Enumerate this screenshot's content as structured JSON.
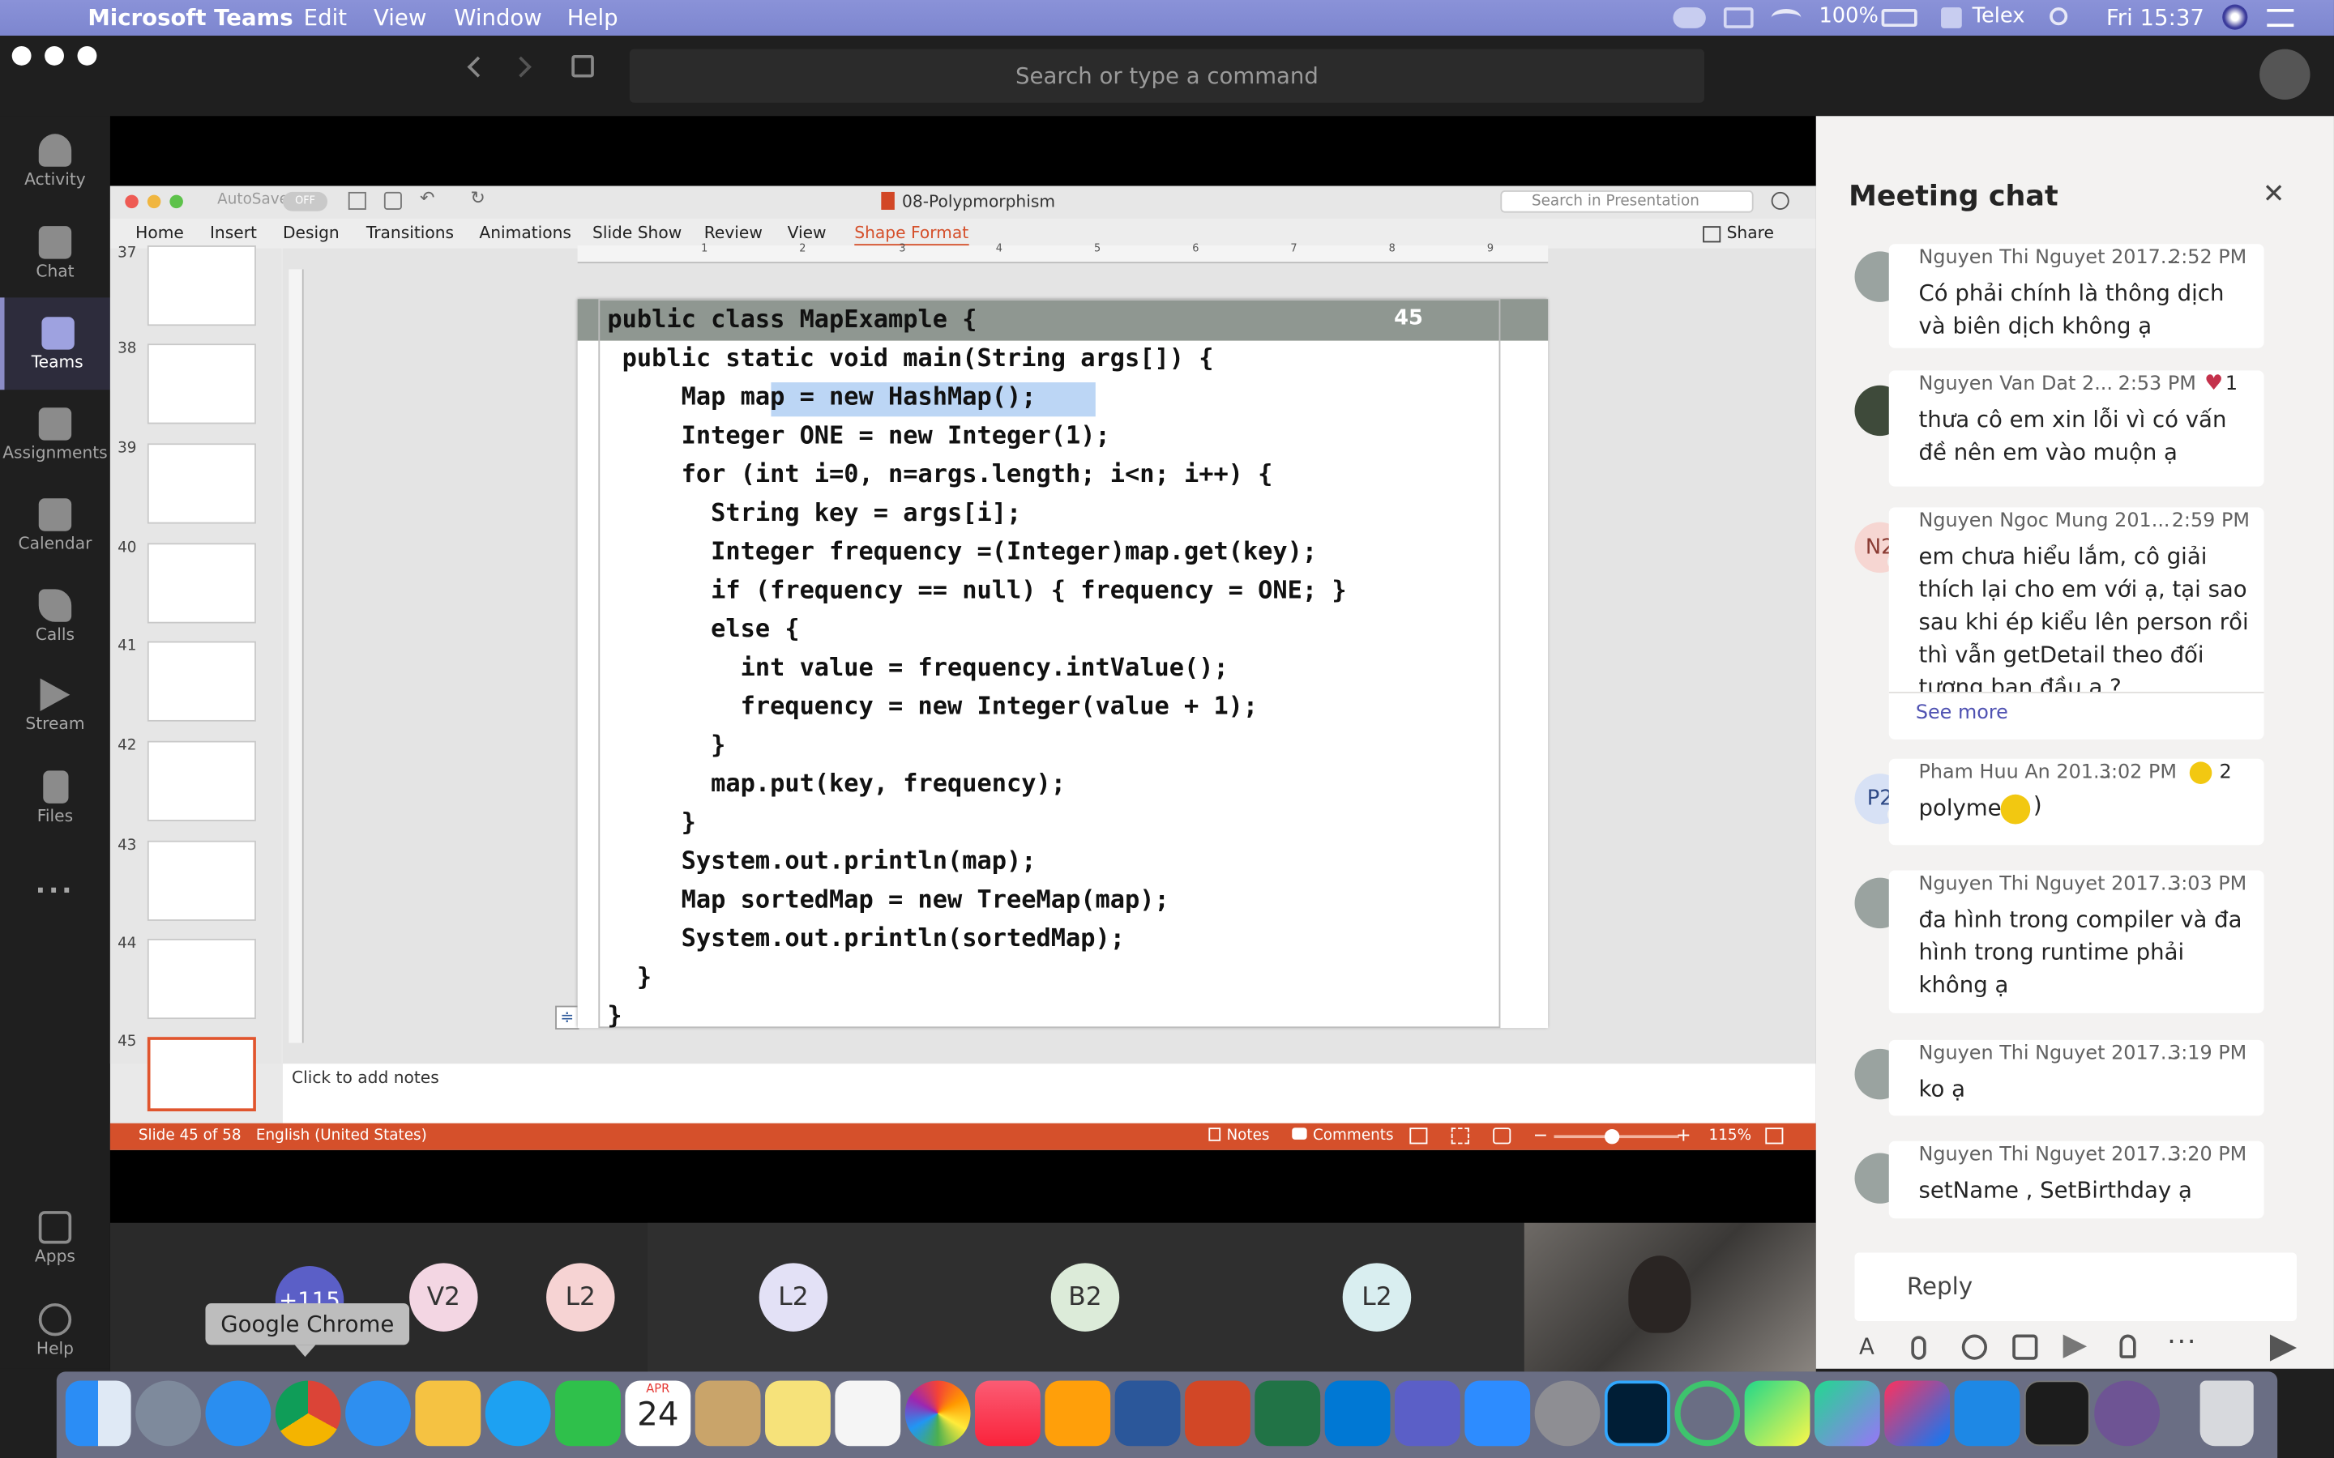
{
  "menubar": {
    "app_name": "Microsoft Teams",
    "menus": [
      "Edit",
      "View",
      "Window",
      "Help"
    ],
    "battery": "100%",
    "input_method": "Telex",
    "clock": "Fri 15:37"
  },
  "teams_header": {
    "search_placeholder": "Search or type a command"
  },
  "rail": {
    "items": [
      {
        "label": "Activity",
        "icon": "bell-icon"
      },
      {
        "label": "Chat",
        "icon": "chat-icon"
      },
      {
        "label": "Teams",
        "icon": "teams-icon"
      },
      {
        "label": "Assignments",
        "icon": "assignments-icon"
      },
      {
        "label": "Calendar",
        "icon": "calendar-icon"
      },
      {
        "label": "Calls",
        "icon": "phone-icon"
      },
      {
        "label": "Stream",
        "icon": "stream-icon"
      },
      {
        "label": "Files",
        "icon": "files-icon"
      },
      {
        "label": "...",
        "icon": "more-icon"
      },
      {
        "label": "Apps",
        "icon": "apps-icon"
      },
      {
        "label": "Help",
        "icon": "help-icon"
      }
    ]
  },
  "powerpoint": {
    "autosave_label": "AutoSave",
    "autosave_state": "OFF",
    "doc_title": "08-Polypmorphism",
    "search_placeholder": "Search in Presentation",
    "share_label": "Share",
    "tabs": [
      "Home",
      "Insert",
      "Design",
      "Transitions",
      "Animations",
      "Slide Show",
      "Review",
      "View",
      "Shape Format"
    ],
    "ruler_numbers": [
      "1",
      "2",
      "3",
      "4",
      "5",
      "6",
      "7",
      "8",
      "9"
    ],
    "slide_numbers": [
      "37",
      "38",
      "39",
      "40",
      "41",
      "42",
      "43",
      "44",
      "45"
    ],
    "slide": {
      "page_number": "45",
      "code_lines": [
        "public class MapExample {",
        " public static void main(String args[]) {",
        "     Map map = new HashMap();",
        "     Integer ONE = new Integer(1);",
        "     for (int i=0, n=args.length; i<n; i++) {",
        "       String key = args[i];",
        "       Integer frequency =(Integer)map.get(key);",
        "       if (frequency == null) { frequency = ONE; }",
        "       else {",
        "         int value = frequency.intValue();",
        "         frequency = new Integer(value + 1);",
        "       }",
        "       map.put(key, frequency);",
        "     }",
        "     System.out.println(map);",
        "     Map sortedMap = new TreeMap(map);",
        "     System.out.println(sortedMap);",
        "  }",
        "}"
      ]
    },
    "notes_placeholder": "Click to add notes",
    "status": {
      "slide_info": "Slide 45 of 58",
      "language": "English (United States)",
      "notes_label": "Notes",
      "comments_label": "Comments",
      "zoom": "115%"
    },
    "accent_color": "#d5502b"
  },
  "video_strip": {
    "participants": [
      {
        "initials": "+115",
        "color": "#5b5fc7"
      },
      {
        "initials": "V2",
        "color": "#f3d6e3"
      },
      {
        "initials": "L2",
        "color": "#f6d3d3"
      },
      {
        "initials": "L2",
        "color": "#e3e1f6"
      },
      {
        "initials": "B2",
        "color": "#dcebd9"
      },
      {
        "initials": "L2",
        "color": "#d9eef0"
      }
    ]
  },
  "tooltip": "Google Chrome",
  "chat": {
    "title": "Meeting chat",
    "see_more": "See more",
    "reply_placeholder": "Reply",
    "messages": [
      {
        "author": "Nguyen Thi Nguyet 2017...",
        "time": "2:52 PM",
        "text": "Có phải chính là thông dịch và biên dịch không ạ",
        "reaction": ""
      },
      {
        "author": "Nguyen Van Dat 2...",
        "time": "2:53 PM",
        "text": "thưa cô em xin lỗi vì có vấn đề nên em vào muộn ạ",
        "reaction": "1"
      },
      {
        "author": "Nguyen Ngoc Mung 201...",
        "time": "2:59 PM",
        "text": "em chưa hiểu lắm, cô giải thích lại cho em với ạ, tại sao sau khi ép kiểu lên person rồi thì vẫn getDetail theo đối tượng ban đầu ạ ?",
        "avatar": "N2",
        "reaction": ""
      },
      {
        "author": "Pham Huu An 201...",
        "time": "3:02 PM",
        "text": "polyme",
        "avatar": "P2",
        "reaction": "2"
      },
      {
        "author": "Nguyen Thi Nguyet 2017...",
        "time": "3:03 PM",
        "text": "đa hình trong compiler và đa hình trong runtime phải không ạ",
        "reaction": ""
      },
      {
        "author": "Nguyen Thi Nguyet 2017...",
        "time": "3:19 PM",
        "text": "ko ạ",
        "reaction": ""
      },
      {
        "author": "Nguyen Thi Nguyet 2017...",
        "time": "3:20 PM",
        "text": "setName , SetBirthday ạ",
        "reaction": ""
      }
    ]
  },
  "dock": {
    "calendar_month": "APR",
    "calendar_day": "24",
    "apps": [
      "finder-icon",
      "launchpad-icon",
      "safari-icon",
      "chrome-icon",
      "messenger-icon",
      "bulb-icon",
      "skype-icon",
      "line-icon",
      "calendar-icon",
      "eagle-icon",
      "notes-icon",
      "reminders-icon",
      "photos-icon",
      "music-icon",
      "books-icon",
      "word-icon",
      "powerpoint-icon",
      "excel-icon",
      "outlook-icon",
      "teams-icon",
      "zoom-icon",
      "system-preferences-icon",
      "photoshop-icon",
      "circle-app-icon",
      "pycharm-icon",
      "datagrip-icon",
      "intellij-icon",
      "vscode-icon",
      "terminal-icon",
      "github-icon",
      "trash-icon"
    ]
  }
}
